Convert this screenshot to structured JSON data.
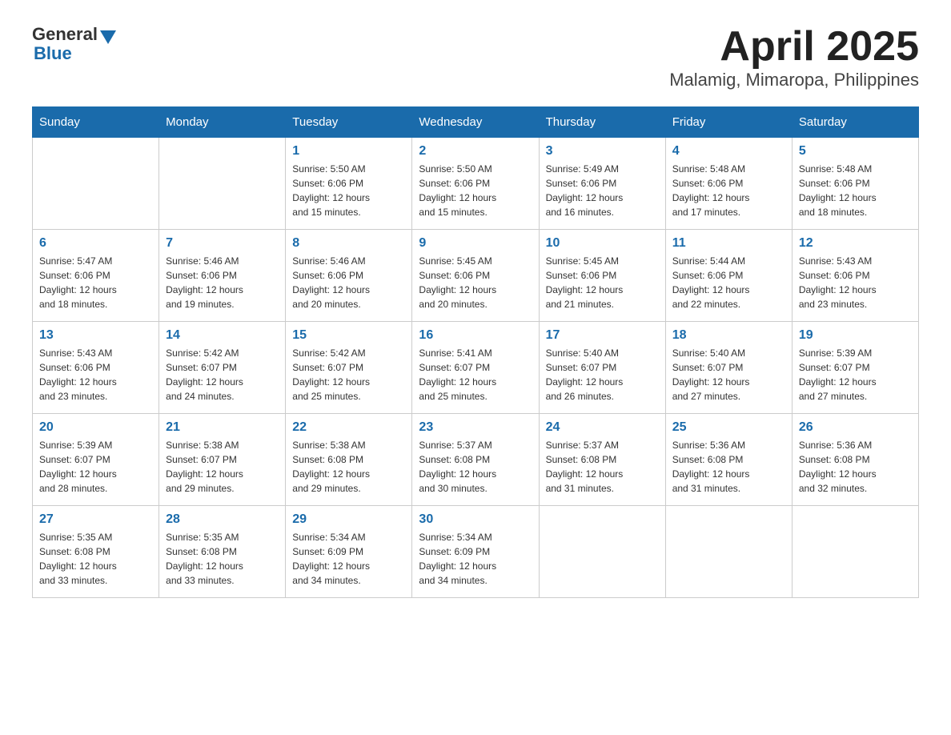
{
  "header": {
    "title": "April 2025",
    "subtitle": "Malamig, Mimaropa, Philippines"
  },
  "logo": {
    "general": "General",
    "blue": "Blue"
  },
  "days": [
    "Sunday",
    "Monday",
    "Tuesday",
    "Wednesday",
    "Thursday",
    "Friday",
    "Saturday"
  ],
  "weeks": [
    [
      {
        "num": "",
        "info": ""
      },
      {
        "num": "",
        "info": ""
      },
      {
        "num": "1",
        "info": "Sunrise: 5:50 AM\nSunset: 6:06 PM\nDaylight: 12 hours\nand 15 minutes."
      },
      {
        "num": "2",
        "info": "Sunrise: 5:50 AM\nSunset: 6:06 PM\nDaylight: 12 hours\nand 15 minutes."
      },
      {
        "num": "3",
        "info": "Sunrise: 5:49 AM\nSunset: 6:06 PM\nDaylight: 12 hours\nand 16 minutes."
      },
      {
        "num": "4",
        "info": "Sunrise: 5:48 AM\nSunset: 6:06 PM\nDaylight: 12 hours\nand 17 minutes."
      },
      {
        "num": "5",
        "info": "Sunrise: 5:48 AM\nSunset: 6:06 PM\nDaylight: 12 hours\nand 18 minutes."
      }
    ],
    [
      {
        "num": "6",
        "info": "Sunrise: 5:47 AM\nSunset: 6:06 PM\nDaylight: 12 hours\nand 18 minutes."
      },
      {
        "num": "7",
        "info": "Sunrise: 5:46 AM\nSunset: 6:06 PM\nDaylight: 12 hours\nand 19 minutes."
      },
      {
        "num": "8",
        "info": "Sunrise: 5:46 AM\nSunset: 6:06 PM\nDaylight: 12 hours\nand 20 minutes."
      },
      {
        "num": "9",
        "info": "Sunrise: 5:45 AM\nSunset: 6:06 PM\nDaylight: 12 hours\nand 20 minutes."
      },
      {
        "num": "10",
        "info": "Sunrise: 5:45 AM\nSunset: 6:06 PM\nDaylight: 12 hours\nand 21 minutes."
      },
      {
        "num": "11",
        "info": "Sunrise: 5:44 AM\nSunset: 6:06 PM\nDaylight: 12 hours\nand 22 minutes."
      },
      {
        "num": "12",
        "info": "Sunrise: 5:43 AM\nSunset: 6:06 PM\nDaylight: 12 hours\nand 23 minutes."
      }
    ],
    [
      {
        "num": "13",
        "info": "Sunrise: 5:43 AM\nSunset: 6:06 PM\nDaylight: 12 hours\nand 23 minutes."
      },
      {
        "num": "14",
        "info": "Sunrise: 5:42 AM\nSunset: 6:07 PM\nDaylight: 12 hours\nand 24 minutes."
      },
      {
        "num": "15",
        "info": "Sunrise: 5:42 AM\nSunset: 6:07 PM\nDaylight: 12 hours\nand 25 minutes."
      },
      {
        "num": "16",
        "info": "Sunrise: 5:41 AM\nSunset: 6:07 PM\nDaylight: 12 hours\nand 25 minutes."
      },
      {
        "num": "17",
        "info": "Sunrise: 5:40 AM\nSunset: 6:07 PM\nDaylight: 12 hours\nand 26 minutes."
      },
      {
        "num": "18",
        "info": "Sunrise: 5:40 AM\nSunset: 6:07 PM\nDaylight: 12 hours\nand 27 minutes."
      },
      {
        "num": "19",
        "info": "Sunrise: 5:39 AM\nSunset: 6:07 PM\nDaylight: 12 hours\nand 27 minutes."
      }
    ],
    [
      {
        "num": "20",
        "info": "Sunrise: 5:39 AM\nSunset: 6:07 PM\nDaylight: 12 hours\nand 28 minutes."
      },
      {
        "num": "21",
        "info": "Sunrise: 5:38 AM\nSunset: 6:07 PM\nDaylight: 12 hours\nand 29 minutes."
      },
      {
        "num": "22",
        "info": "Sunrise: 5:38 AM\nSunset: 6:08 PM\nDaylight: 12 hours\nand 29 minutes."
      },
      {
        "num": "23",
        "info": "Sunrise: 5:37 AM\nSunset: 6:08 PM\nDaylight: 12 hours\nand 30 minutes."
      },
      {
        "num": "24",
        "info": "Sunrise: 5:37 AM\nSunset: 6:08 PM\nDaylight: 12 hours\nand 31 minutes."
      },
      {
        "num": "25",
        "info": "Sunrise: 5:36 AM\nSunset: 6:08 PM\nDaylight: 12 hours\nand 31 minutes."
      },
      {
        "num": "26",
        "info": "Sunrise: 5:36 AM\nSunset: 6:08 PM\nDaylight: 12 hours\nand 32 minutes."
      }
    ],
    [
      {
        "num": "27",
        "info": "Sunrise: 5:35 AM\nSunset: 6:08 PM\nDaylight: 12 hours\nand 33 minutes."
      },
      {
        "num": "28",
        "info": "Sunrise: 5:35 AM\nSunset: 6:08 PM\nDaylight: 12 hours\nand 33 minutes."
      },
      {
        "num": "29",
        "info": "Sunrise: 5:34 AM\nSunset: 6:09 PM\nDaylight: 12 hours\nand 34 minutes."
      },
      {
        "num": "30",
        "info": "Sunrise: 5:34 AM\nSunset: 6:09 PM\nDaylight: 12 hours\nand 34 minutes."
      },
      {
        "num": "",
        "info": ""
      },
      {
        "num": "",
        "info": ""
      },
      {
        "num": "",
        "info": ""
      }
    ]
  ]
}
